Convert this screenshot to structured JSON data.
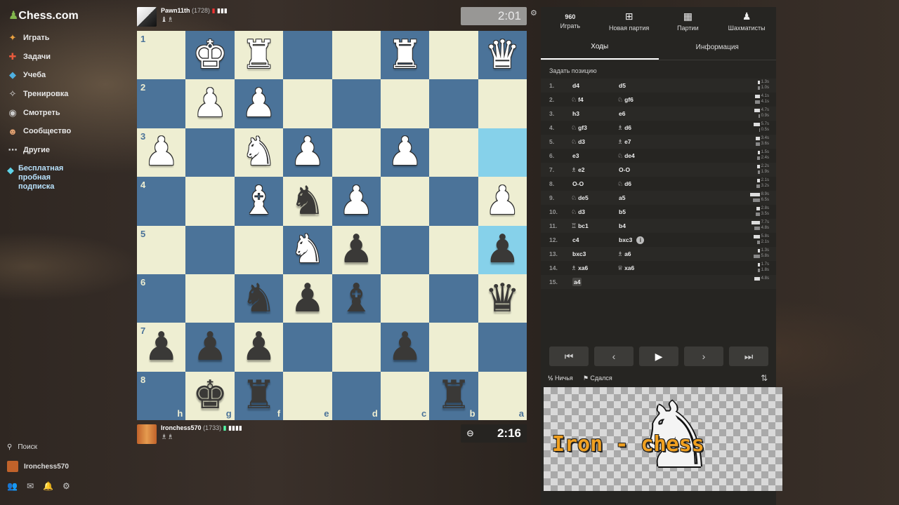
{
  "app": {
    "logo_text": "Chess.com"
  },
  "sidebar": {
    "items": [
      {
        "label": "Играть",
        "icon": "play-icon"
      },
      {
        "label": "Задачи",
        "icon": "puzzle-icon"
      },
      {
        "label": "Учеба",
        "icon": "learn-icon"
      },
      {
        "label": "Тренировка",
        "icon": "practice-icon"
      },
      {
        "label": "Смотреть",
        "icon": "watch-icon"
      },
      {
        "label": "Сообщество",
        "icon": "community-icon"
      },
      {
        "label": "Другие",
        "icon": "more-icon"
      }
    ],
    "promo": "Бесплатная пробная подписка",
    "search": "Поиск",
    "username": "Ironchess570"
  },
  "players": {
    "top": {
      "name": "Pawn11th",
      "rating": "(1728)",
      "captured": "♝♗",
      "clock": "2:01"
    },
    "bottom": {
      "name": "Ironchess570",
      "rating": "(1733)",
      "captured": "♗♗",
      "clock": "2:16"
    }
  },
  "board": {
    "orientation": "black",
    "ranks": [
      "1",
      "2",
      "3",
      "4",
      "5",
      "6",
      "7",
      "8"
    ],
    "files": [
      "h",
      "g",
      "f",
      "e",
      "d",
      "c",
      "b",
      "a"
    ],
    "highlighted": [
      "2-7",
      "4-7"
    ],
    "rows": [
      [
        "",
        "wK",
        "wR",
        "",
        "",
        "wR",
        "",
        "wQ"
      ],
      [
        "",
        "wP",
        "wP",
        "",
        "",
        "",
        "",
        ""
      ],
      [
        "wP",
        "",
        "wN",
        "wP",
        "",
        "wP",
        "",
        ""
      ],
      [
        "",
        "",
        "wB",
        "bN",
        "wP",
        "",
        "",
        "wP"
      ],
      [
        "",
        "",
        "",
        "wN",
        "bP",
        "",
        "",
        "bP"
      ],
      [
        "",
        "",
        "bN",
        "bP",
        "bB",
        "",
        "",
        "bQ"
      ],
      [
        "bP",
        "bP",
        "bP",
        "",
        "",
        "bP",
        "",
        ""
      ],
      [
        "",
        "bK",
        "bR",
        "",
        "",
        "",
        "bR",
        ""
      ]
    ]
  },
  "panel": {
    "topnav": [
      {
        "label": "Играть",
        "icon": "960"
      },
      {
        "label": "Новая партия",
        "icon": "plus-icon"
      },
      {
        "label": "Партии",
        "icon": "board-icon"
      },
      {
        "label": "Шахматисты",
        "icon": "players-icon"
      }
    ],
    "tabs": [
      "Ходы",
      "Информация"
    ],
    "set_position": "Задать позицию",
    "moves": [
      {
        "num": "1.",
        "w": "d4",
        "wf": "",
        "b": "d5",
        "bf": "",
        "tw": "1.3s",
        "tb": "1.0s",
        "bw": 3,
        "bb": 3
      },
      {
        "num": "2.",
        "w": "f4",
        "wf": "♘",
        "b": "gf6",
        "bf": "♘",
        "tw": "4.1s",
        "tb": "4.1s",
        "bw": 7,
        "bb": 7
      },
      {
        "num": "3.",
        "w": "h3",
        "wf": "",
        "b": "e6",
        "bf": "",
        "tw": "4.7s",
        "tb": "0.9s",
        "bw": 8,
        "bb": 2
      },
      {
        "num": "4.",
        "w": "gf3",
        "wf": "♘",
        "b": "d6",
        "bf": "♗",
        "tw": "5.7s",
        "tb": "0.5s",
        "bw": 9,
        "bb": 1
      },
      {
        "num": "5.",
        "w": "d3",
        "wf": "♘",
        "b": "e7",
        "bf": "♗",
        "tw": "3.4s",
        "tb": "3.6s",
        "bw": 6,
        "bb": 6
      },
      {
        "num": "6.",
        "w": "e3",
        "wf": "",
        "b": "de4",
        "bf": "♘",
        "tw": "1.5s",
        "tb": "2.4s",
        "bw": 3,
        "bb": 4
      },
      {
        "num": "7.",
        "w": "e2",
        "wf": "♗",
        "b": "O-O",
        "bf": "",
        "tw": "2.2s",
        "tb": "1.9s",
        "bw": 4,
        "bb": 3
      },
      {
        "num": "8.",
        "w": "O-O",
        "wf": "",
        "b": "d6",
        "bf": "♘",
        "tw": "2.1s",
        "tb": "3.2s",
        "bw": 4,
        "bb": 5
      },
      {
        "num": "9.",
        "w": "de5",
        "wf": "♘",
        "b": "a5",
        "bf": "",
        "tw": "8.9s",
        "tb": "6.5s",
        "bw": 14,
        "bb": 10
      },
      {
        "num": "10.",
        "w": "d3",
        "wf": "♘",
        "b": "b5",
        "bf": "",
        "tw": "2.8s",
        "tb": "3.5s",
        "bw": 5,
        "bb": 6
      },
      {
        "num": "11.",
        "w": "bc1",
        "wf": "♖",
        "b": "b4",
        "bf": "",
        "tw": "7.7s",
        "tb": "4.8s",
        "bw": 12,
        "bb": 8
      },
      {
        "num": "12.",
        "w": "c4",
        "wf": "",
        "b": "bxc3",
        "bf": "",
        "tw": "5.8s",
        "tb": "2.1s",
        "bw": 9,
        "bb": 4,
        "info": "i"
      },
      {
        "num": "13.",
        "w": "bxc3",
        "wf": "",
        "b": "a6",
        "bf": "♗",
        "tw": "1.3s",
        "tb": "5.8s",
        "bw": 3,
        "bb": 9
      },
      {
        "num": "14.",
        "w": "xa6",
        "wf": "♗",
        "b": "xa6",
        "bf": "♕",
        "tw": "1.7s",
        "tb": "1.8s",
        "bw": 3,
        "bb": 3
      },
      {
        "num": "15.",
        "w": "a4",
        "wf": "",
        "b": "",
        "bf": "",
        "tw": "4.8s",
        "tb": "",
        "bw": 8,
        "bb": 0,
        "current": true
      }
    ],
    "controls": [
      "⏮",
      "‹",
      "▶",
      "›",
      "⏭"
    ],
    "draw_label": "Ничья",
    "draw_prefix": "½",
    "resign_label": "Сдался",
    "channel_text": "Iron - chess"
  },
  "colors": {
    "light_square": "#eeeed2",
    "dark_square": "#4b7399",
    "highlight": "#86d1ea",
    "panel_bg": "#262522",
    "accent_green": "#81b64c"
  }
}
